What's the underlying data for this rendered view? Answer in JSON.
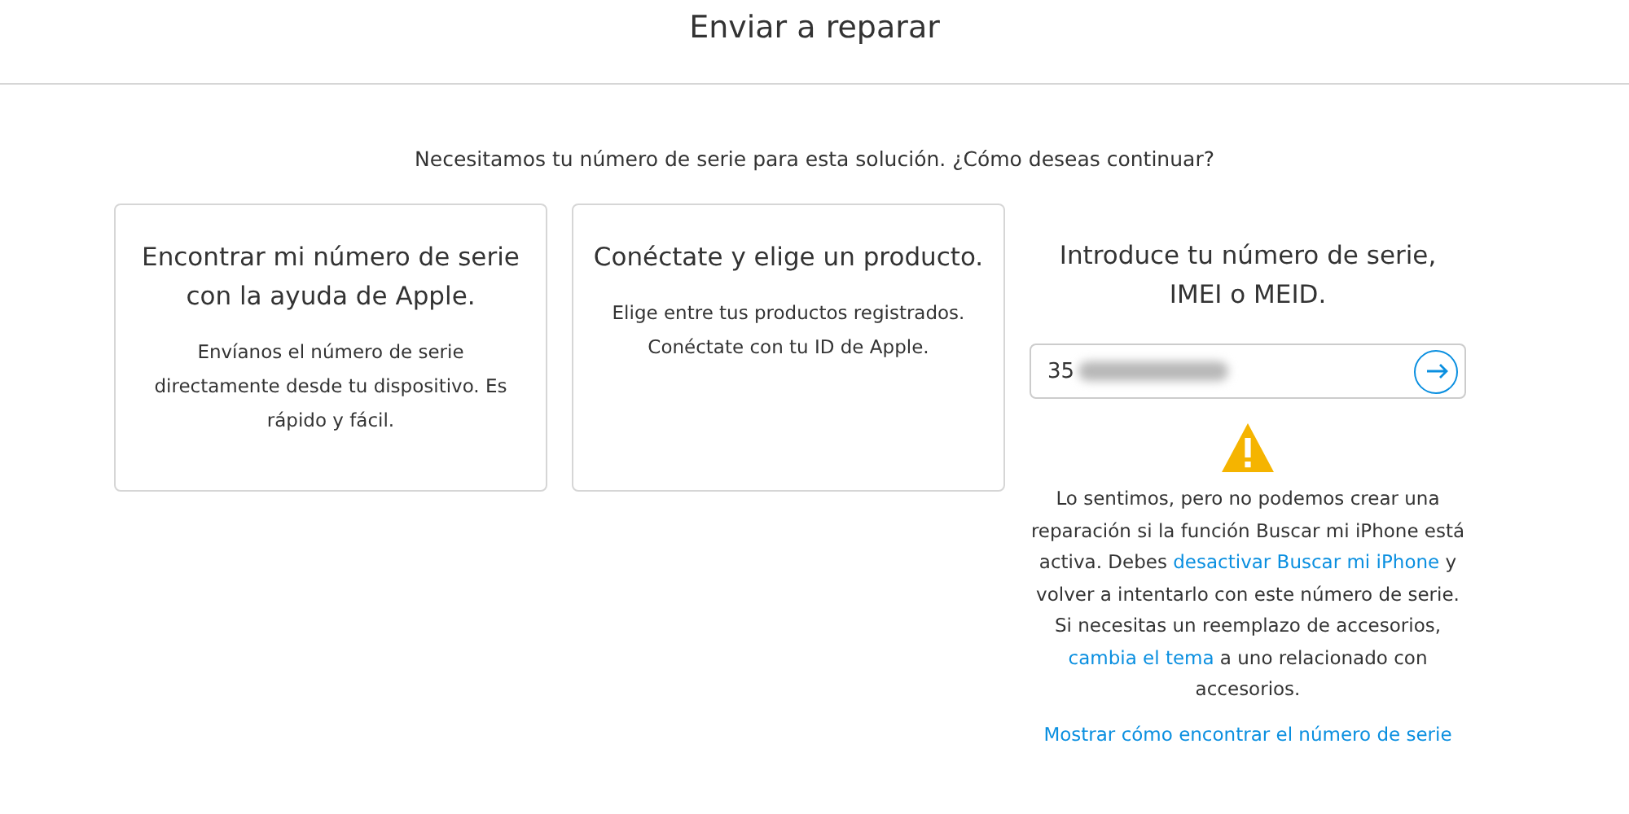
{
  "header": {
    "title": "Enviar a reparar"
  },
  "question": "Necesitamos tu número de serie para esta solución. ¿Cómo deseas continuar?",
  "cards": [
    {
      "title": "Encontrar mi número de serie con la ayuda de Apple.",
      "body": "Envíanos el número de serie directamente desde tu dispositivo. Es rápido y fácil."
    },
    {
      "title": "Conéctate y elige un producto.",
      "body": "Elige entre tus productos registrados. Conéctate con tu ID de Apple."
    }
  ],
  "serial_entry": {
    "title": "Introduce tu número de serie, IMEI o MEID.",
    "value": "35",
    "redacted": true
  },
  "warning": {
    "message": [
      {
        "kind": "text",
        "text": "Lo sentimos, pero no podemos crear una reparación si la función Buscar mi iPhone está activa. Debes "
      },
      {
        "kind": "link",
        "text": "desactivar Buscar mi iPhone"
      },
      {
        "kind": "text",
        "text": " y volver a intentarlo con este número de serie. Si necesitas un reemplazo de accesorios, "
      },
      {
        "kind": "link",
        "text": "cambia el tema"
      },
      {
        "kind": "text",
        "text": " a uno relacionado con accesorios."
      }
    ]
  },
  "help_link": "Mostrar cómo encontrar el número de serie"
}
